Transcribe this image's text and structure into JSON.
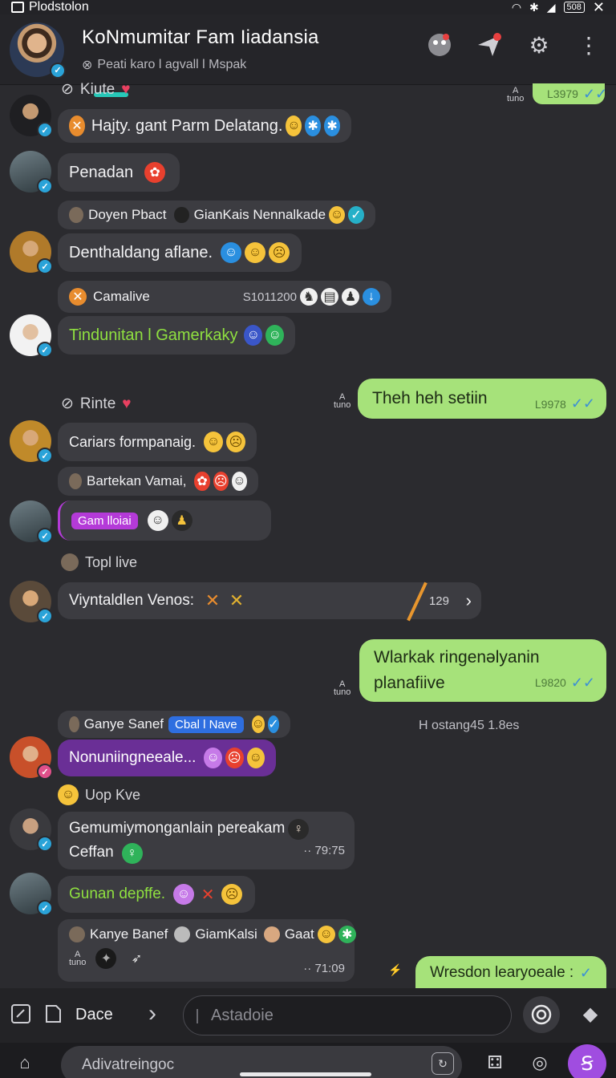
{
  "status_bar": {
    "app_name": "Plodstolon",
    "battery": "508"
  },
  "header": {
    "title": "KoNmumitar Fam Iiadansia",
    "subtitle": "Peati karo l agvall l Mspak"
  },
  "colors": {
    "accent": "#27c8b8",
    "outgoing": "#a6e27a",
    "purple": "#a04de0",
    "verified": "#2aa3d8"
  },
  "messages": {
    "label1": "Kiute",
    "m1": "Hajty. gant Parm Delatang.",
    "out_top_time": "L3979",
    "m2": "Penadan",
    "m3_names": {
      "a": "Doyen Pbact",
      "b": "GianKais Nennalkade"
    },
    "m4": "Denthaldang aflane.",
    "m5": {
      "text": "Camalive",
      "num": "S1011200"
    },
    "m6": "Tindunitan l Gamerkaky",
    "label2": "Rinte",
    "out1": {
      "text": "Theh heh setiin",
      "time": "L9978"
    },
    "m7": "Cariars formpanaig.",
    "m8": "Bartekan Vamai,",
    "m9_tag": "Gam lloiai",
    "m10": "Topl live",
    "m11": {
      "text": "Viyntaldlen Venos:",
      "count": "129"
    },
    "out2": {
      "line1": "Wlarkak ringenəlyanin",
      "line2": "planafiive",
      "time": "L9820"
    },
    "m12": {
      "name": "Ganye Sanef",
      "tag": "Cbal l Nave"
    },
    "sys1": "H ostang45 1.8es",
    "m13": "Nonuniingneeale...",
    "m14": "Uop Kve",
    "m15": {
      "line1": "Gemumiymonganlain pereakam",
      "line2": "Ceffan",
      "time": "79:75"
    },
    "m16": "Gunan depffe.",
    "m17": {
      "a": "Kanye Banef",
      "b": "GiamKalsi",
      "c": "Gaat",
      "time": "71:09"
    },
    "out3": "Wresdon learyoeale :"
  },
  "a_mark": {
    "top": "A",
    "bottom": "tuno"
  },
  "composer": {
    "label": "Dace",
    "placeholder": "Astadoie"
  },
  "nav": {
    "input_text": "Adivatreingoc"
  }
}
